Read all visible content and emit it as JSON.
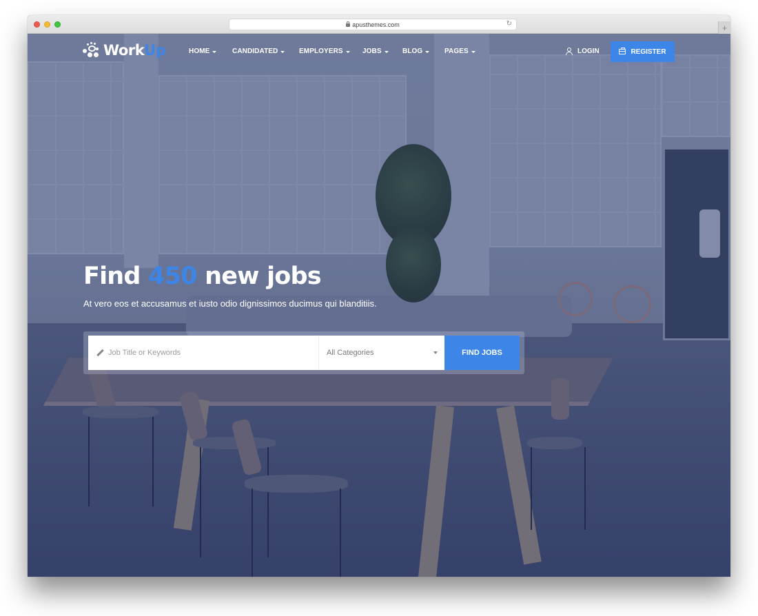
{
  "browser": {
    "url": "apusthemes.com",
    "new_tab_label": "+"
  },
  "header": {
    "logo": {
      "part1": "Work",
      "part2": "Up"
    },
    "nav": [
      {
        "label": "HOME"
      },
      {
        "label": "CANDIDATED"
      },
      {
        "label": "EMPLOYERS"
      },
      {
        "label": "JOBS"
      },
      {
        "label": "BLOG"
      },
      {
        "label": "PAGES"
      }
    ],
    "login_label": "LOGIN",
    "register_label": "REGISTER"
  },
  "hero": {
    "title_prefix": "Find ",
    "title_number": "450",
    "title_suffix": " new jobs",
    "subtitle": "At vero eos et accusamus et iusto odio dignissimos ducimus qui blanditiis."
  },
  "search": {
    "keyword_placeholder": "Job Title or Keywords",
    "keyword_value": "",
    "category_selected": "All Categories",
    "submit_label": "FIND JOBS"
  },
  "colors": {
    "accent": "#3d86e8",
    "overlay": "#28345c"
  }
}
